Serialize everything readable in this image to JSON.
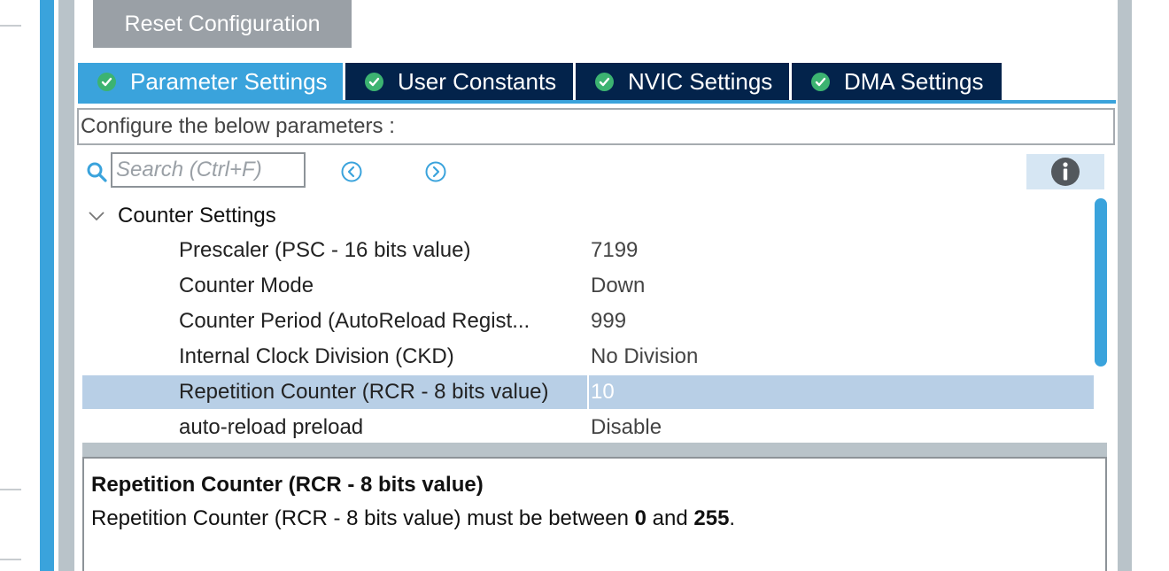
{
  "reset_button": {
    "label": "Reset Configuration"
  },
  "tabs": [
    {
      "label": "Parameter Settings",
      "active": true
    },
    {
      "label": "User Constants",
      "active": false
    },
    {
      "label": "NVIC Settings",
      "active": false
    },
    {
      "label": "DMA Settings",
      "active": false
    }
  ],
  "header_text": "Configure the below parameters :",
  "search": {
    "placeholder": "Search (Ctrl+F)",
    "value": ""
  },
  "group": {
    "label": "Counter Settings",
    "expanded": true
  },
  "params": [
    {
      "name": "Prescaler (PSC - 16 bits value)",
      "value": "7199"
    },
    {
      "name": "Counter Mode",
      "value": "Down"
    },
    {
      "name": "Counter Period (AutoReload Regist...",
      "value": "999"
    },
    {
      "name": "Internal Clock Division (CKD)",
      "value": "No Division"
    },
    {
      "name": "Repetition Counter (RCR - 8 bits value)",
      "value": "10",
      "selected": true
    },
    {
      "name": "auto-reload preload",
      "value": "Disable"
    }
  ],
  "description": {
    "title": "Repetition Counter (RCR - 8 bits value)",
    "text_prefix": "Repetition Counter (RCR - 8 bits value) must be between ",
    "min": "0",
    "text_and": " and ",
    "max": "255",
    "text_suffix": "."
  },
  "colors": {
    "accent": "#3aa3dc",
    "tab_dark": "#03234b",
    "check_green": "#3cb371",
    "selection": "#b8cfe6"
  },
  "icons": {
    "tab_status": "check-circle-icon",
    "search": "search-icon",
    "prev": "arrow-left-circle-icon",
    "next": "arrow-right-circle-icon",
    "info": "info-icon",
    "group_toggle": "chevron-down-icon"
  }
}
